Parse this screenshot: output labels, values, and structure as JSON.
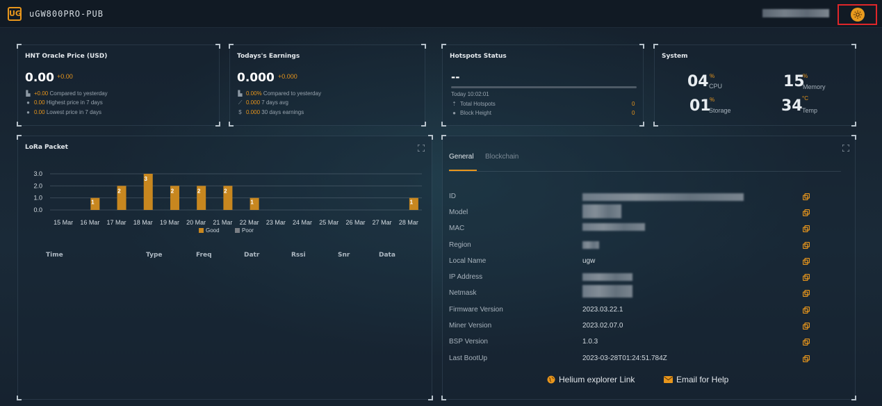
{
  "app": {
    "logo_text": "UG",
    "title": "uGW800PRO-PUB"
  },
  "header": {
    "settings_icon": "gear-icon"
  },
  "hnt": {
    "title": "HNT Oracle Price (USD)",
    "value": "0.00",
    "delta": "+0.00",
    "rows": [
      {
        "icon": "chart-icon",
        "value": "+0.00",
        "label": "Compared to yesterday"
      },
      {
        "icon": "arrow-up-icon",
        "value": "0.00",
        "label": "Highest price in 7 days"
      },
      {
        "icon": "arrow-down-icon",
        "value": "0.00",
        "label": "Lowest price in 7 days"
      }
    ]
  },
  "earnings": {
    "title": "Todays's Earnings",
    "value": "0.000",
    "delta": "+0.000",
    "rows": [
      {
        "icon": "chart-icon",
        "value": "0.00%",
        "label": "Compared to yesterday"
      },
      {
        "icon": "trend-icon",
        "value": "0.000",
        "label": "7 days avg"
      },
      {
        "icon": "dollar-icon",
        "value": "0.000",
        "label": "30 days earnings"
      }
    ]
  },
  "hotspots": {
    "title": "Hotspots Status",
    "value": "--",
    "time": "Today 10:02:01",
    "progress": 0,
    "rows": [
      {
        "icon": "hotspot-icon",
        "label": "Total Hotspots",
        "value": "0"
      },
      {
        "icon": "block-icon",
        "label": "Block Height",
        "value": "0"
      }
    ]
  },
  "system": {
    "title": "System",
    "cpu": {
      "value": "04",
      "unit": "%",
      "label": "CPU"
    },
    "memory": {
      "value": "15",
      "unit": "%",
      "label": "Memory"
    },
    "storage": {
      "value": "01",
      "unit": "%",
      "label": "Storage"
    },
    "temp": {
      "value": "34",
      "unit": "°C",
      "label": "Temp"
    }
  },
  "lora": {
    "title": "LoRa Packet",
    "table_headers": [
      "Time",
      "Type",
      "Freq",
      "Datr",
      "Rssi",
      "Snr",
      "Data"
    ]
  },
  "chart_data": {
    "type": "bar",
    "title": "",
    "categories": [
      "15 Mar",
      "16 Mar",
      "17 Mar",
      "18 Mar",
      "19 Mar",
      "20 Mar",
      "21 Mar",
      "22 Mar",
      "23 Mar",
      "24 Mar",
      "25 Mar",
      "26 Mar",
      "27 Mar",
      "28 Mar"
    ],
    "series": [
      {
        "name": "Good",
        "color": "#c8871f",
        "values": [
          0,
          1,
          2,
          3,
          2,
          2,
          2,
          1,
          0,
          0,
          0,
          0,
          0,
          1
        ]
      },
      {
        "name": "Poor",
        "color": "#7a7f85",
        "values": [
          0,
          0,
          0,
          0,
          0,
          0,
          0,
          0,
          0,
          0,
          0,
          0,
          0,
          0
        ]
      }
    ],
    "y_ticks": [
      "0.0",
      "1.0",
      "2.0",
      "3.0"
    ],
    "ylim": [
      0,
      3
    ],
    "legend": "bottom",
    "grid": true
  },
  "details": {
    "tabs": [
      "General",
      "Blockchain"
    ],
    "rows": [
      {
        "label": "ID",
        "value": ""
      },
      {
        "label": "Model",
        "value": ""
      },
      {
        "label": "MAC",
        "value": ""
      },
      {
        "label": "Region",
        "value": ""
      },
      {
        "label": "Local Name",
        "value": "ugw"
      },
      {
        "label": "IP Address",
        "value": ""
      },
      {
        "label": "Netmask",
        "value": ""
      },
      {
        "label": "Firmware Version",
        "value": "2023.03.22.1"
      },
      {
        "label": "Miner Version",
        "value": "2023.02.07.0"
      },
      {
        "label": "BSP Version",
        "value": "1.0.3"
      },
      {
        "label": "Last BootUp",
        "value": "2023-03-28T01:24:51.784Z"
      }
    ],
    "links": [
      {
        "icon": "globe-icon",
        "label": "Helium explorer Link"
      },
      {
        "icon": "mail-icon",
        "label": "Email for Help"
      }
    ]
  },
  "colors": {
    "accent": "#e8961c",
    "highlight_box": "#e0262a"
  }
}
